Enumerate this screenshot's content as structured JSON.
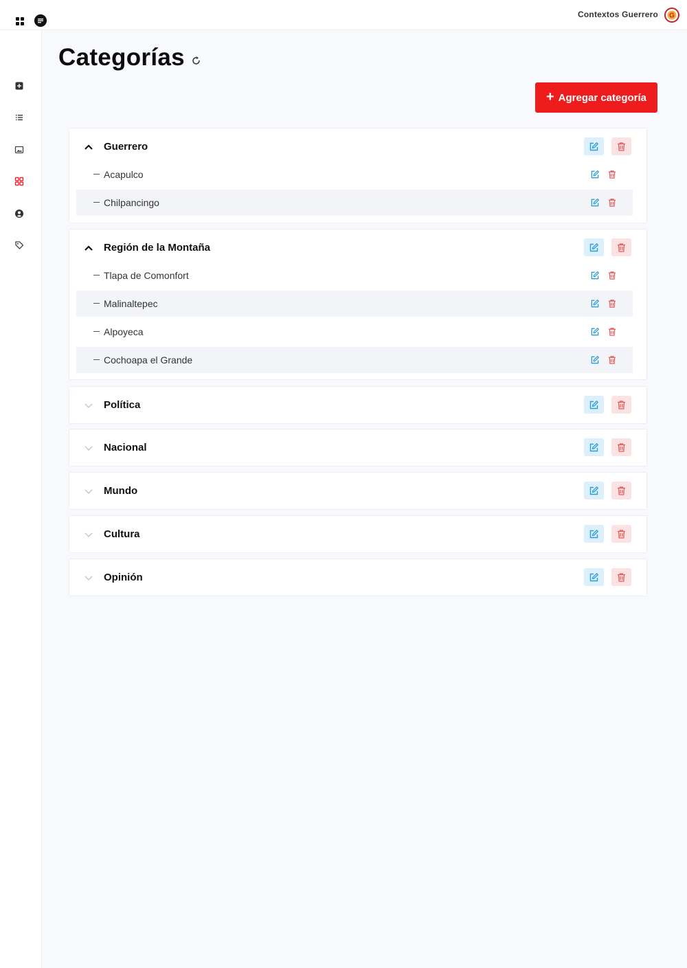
{
  "app": {
    "brand_name": "Contextos Guerrero",
    "accent_color": "#ee1c1c",
    "edit_color": "#2a9fd6",
    "delete_color": "#e85a5a"
  },
  "sidebar": {
    "items": [
      {
        "icon": "plus-square-icon"
      },
      {
        "icon": "list-icon"
      },
      {
        "icon": "image-icon"
      },
      {
        "icon": "grid-icon",
        "active": true
      },
      {
        "icon": "user-circle-icon"
      },
      {
        "icon": "tag-icon"
      }
    ]
  },
  "page": {
    "title": "Categorías",
    "add_button_label": "Agregar categoría"
  },
  "categories": [
    {
      "name": "Guerrero",
      "expanded": true,
      "children": [
        "Acapulco",
        "Chilpancingo"
      ]
    },
    {
      "name": "Región de la Montaña",
      "expanded": true,
      "children": [
        "Tlapa de Comonfort",
        "Malinaltepec",
        "Alpoyeca",
        "Cochoapa el Grande"
      ]
    },
    {
      "name": "Política",
      "expanded": false,
      "children": []
    },
    {
      "name": "Nacional",
      "expanded": false,
      "children": []
    },
    {
      "name": "Mundo",
      "expanded": false,
      "children": []
    },
    {
      "name": "Cultura",
      "expanded": false,
      "children": []
    },
    {
      "name": "Opinión",
      "expanded": false,
      "children": []
    }
  ]
}
